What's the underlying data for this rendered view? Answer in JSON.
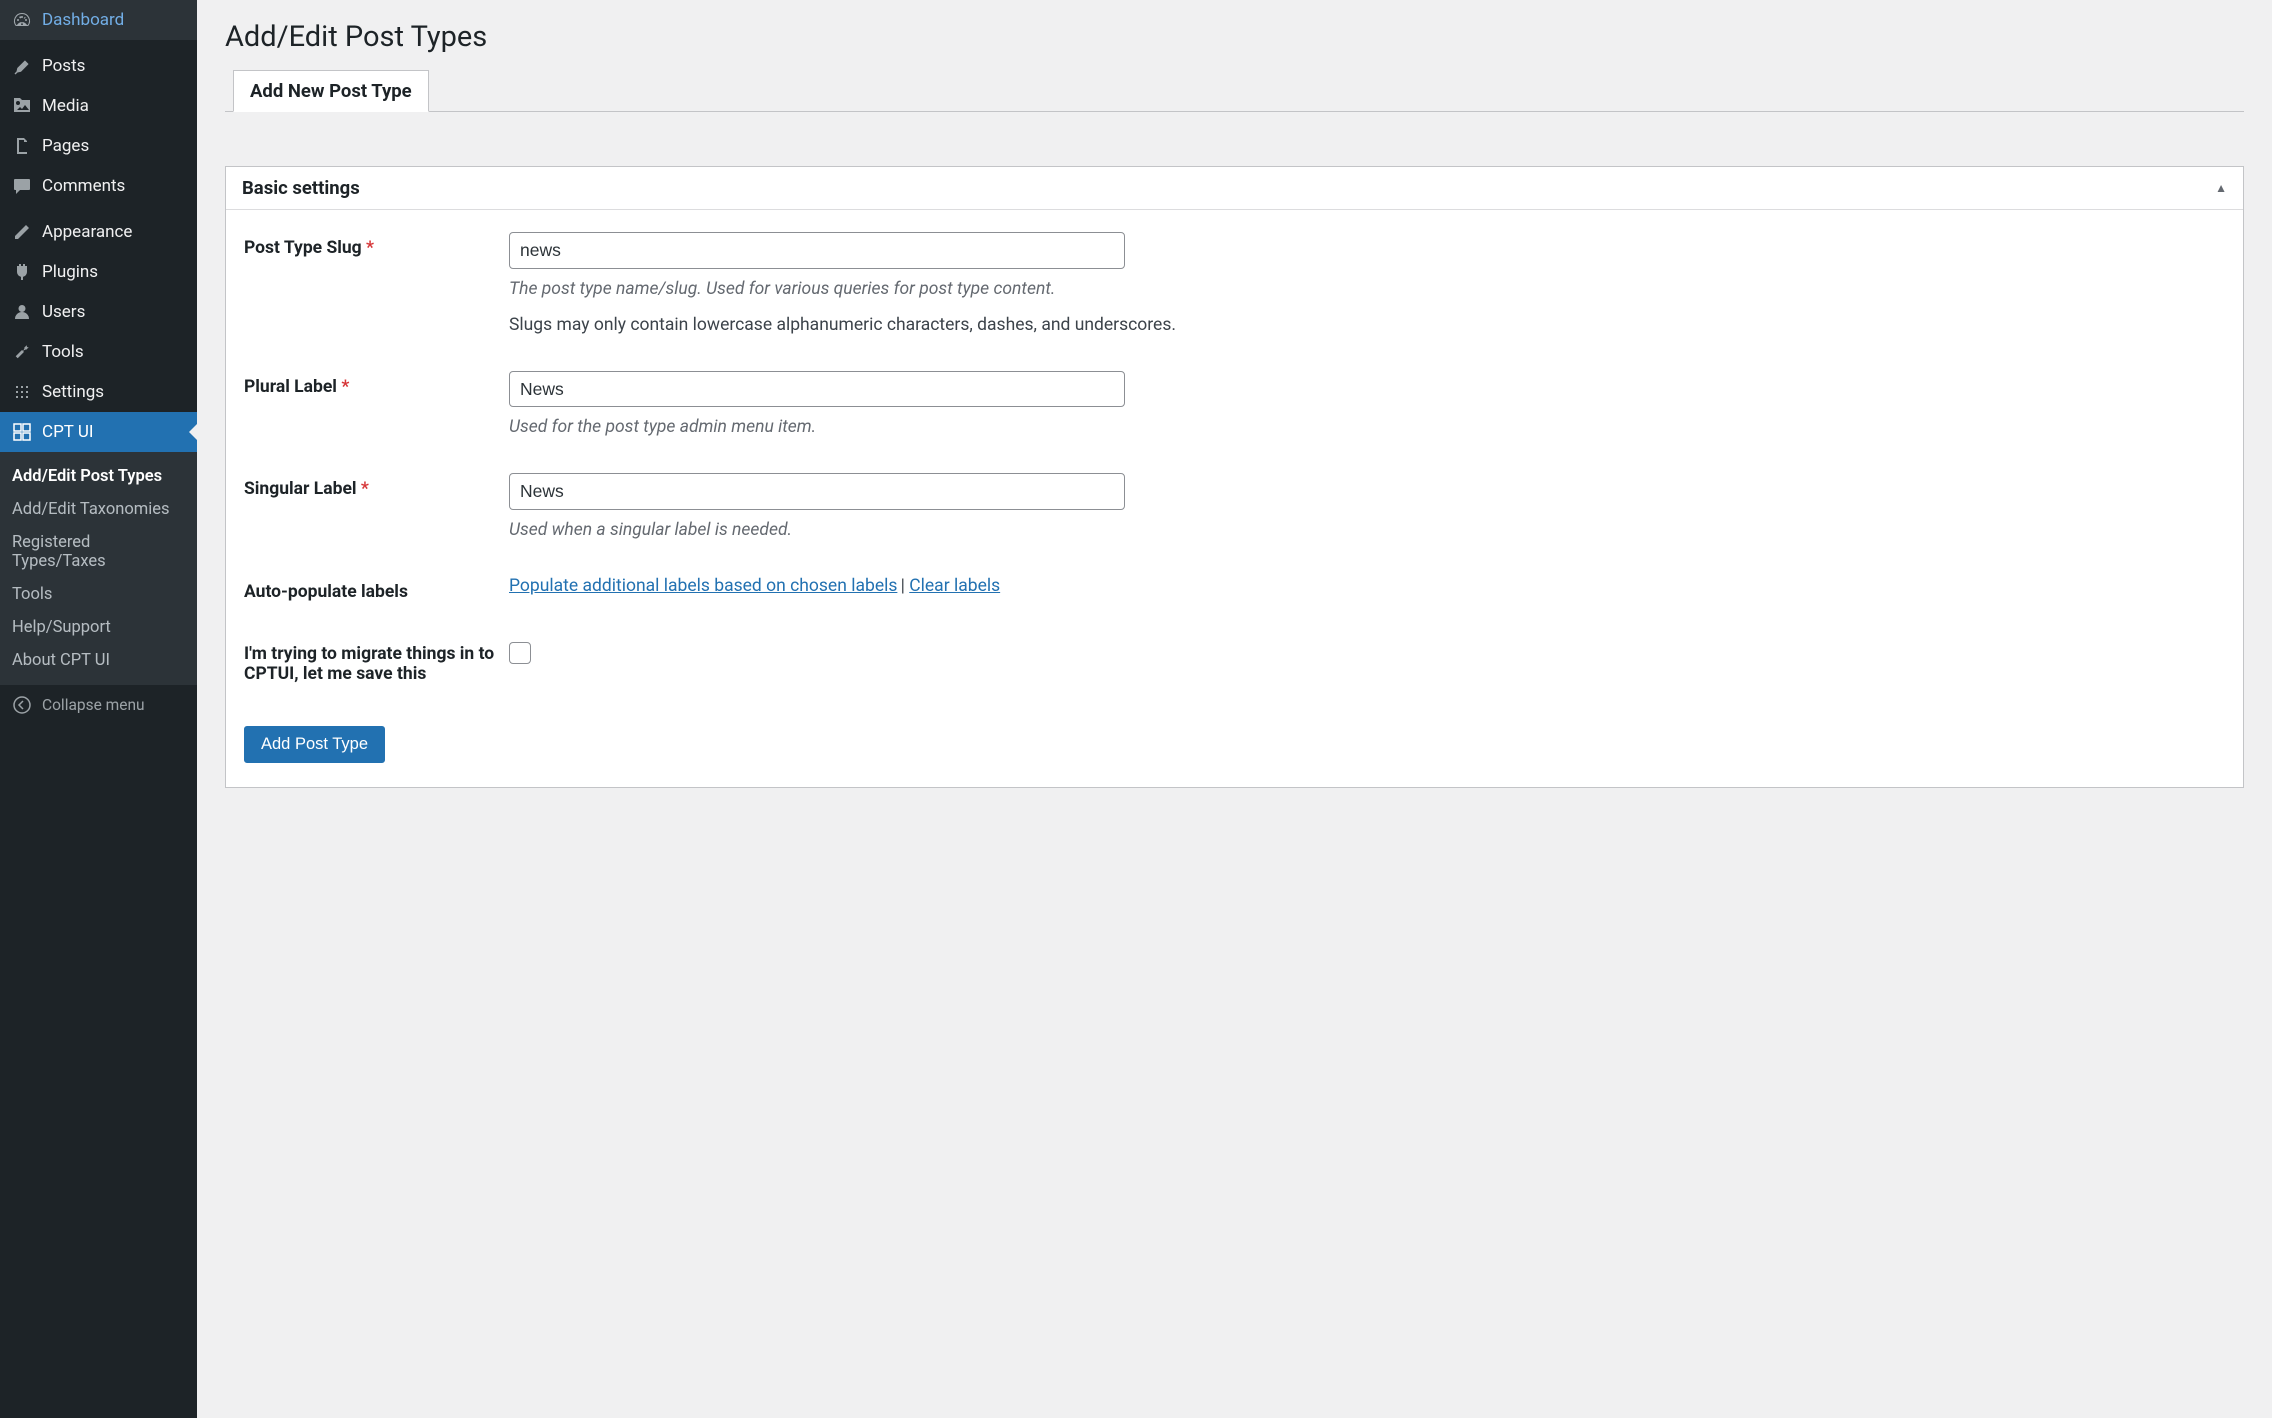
{
  "sidebar": {
    "items": [
      {
        "id": "dashboard",
        "label": "Dashboard",
        "icon": "dashboard"
      },
      {
        "id": "posts",
        "label": "Posts",
        "icon": "pin"
      },
      {
        "id": "media",
        "label": "Media",
        "icon": "media"
      },
      {
        "id": "pages",
        "label": "Pages",
        "icon": "pages"
      },
      {
        "id": "comments",
        "label": "Comments",
        "icon": "comments"
      },
      {
        "id": "appearance",
        "label": "Appearance",
        "icon": "appearance"
      },
      {
        "id": "plugins",
        "label": "Plugins",
        "icon": "plugins"
      },
      {
        "id": "users",
        "label": "Users",
        "icon": "users"
      },
      {
        "id": "tools",
        "label": "Tools",
        "icon": "tools"
      },
      {
        "id": "settings",
        "label": "Settings",
        "icon": "settings"
      },
      {
        "id": "cptui",
        "label": "CPT UI",
        "icon": "cptui",
        "active": true
      }
    ],
    "submenu": [
      {
        "label": "Add/Edit Post Types",
        "current": true
      },
      {
        "label": "Add/Edit Taxonomies"
      },
      {
        "label": "Registered Types/Taxes"
      },
      {
        "label": "Tools"
      },
      {
        "label": "Help/Support"
      },
      {
        "label": "About CPT UI"
      }
    ],
    "collapse_label": "Collapse menu"
  },
  "page": {
    "title": "Add/Edit Post Types",
    "tab": "Add New Post Type",
    "panel_title": "Basic settings"
  },
  "form": {
    "slug": {
      "label": "Post Type Slug",
      "value": "news",
      "description": "The post type name/slug. Used for various queries for post type content.",
      "help": "Slugs may only contain lowercase alphanumeric characters, dashes, and underscores."
    },
    "plural": {
      "label": "Plural Label",
      "value": "News",
      "description": "Used for the post type admin menu item."
    },
    "singular": {
      "label": "Singular Label",
      "value": "News",
      "description": "Used when a singular label is needed."
    },
    "auto_populate": {
      "label": "Auto-populate labels",
      "populate_link": "Populate additional labels based on chosen labels",
      "clear_link": "Clear labels"
    },
    "migrate": {
      "label": "I'm trying to migrate things in to CPTUI, let me save this"
    },
    "submit": "Add Post Type"
  }
}
